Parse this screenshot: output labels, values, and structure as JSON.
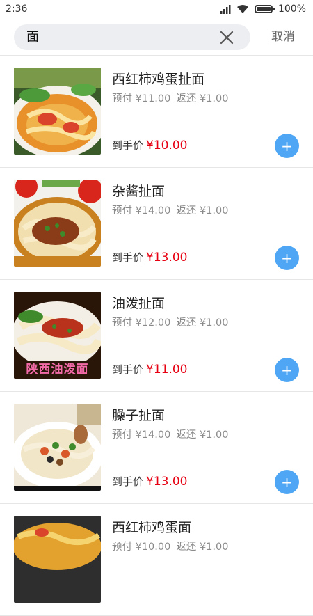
{
  "status": {
    "time": "2:36",
    "battery": "100%",
    "battery_level": 1.0
  },
  "search": {
    "value": "面",
    "cancel_label": "取消"
  },
  "items": [
    {
      "name": "西红柿鸡蛋扯面",
      "prepay": "预付 ¥11.00",
      "rebate": "返还 ¥1.00",
      "final_label": "到手价",
      "final_price": "¥10.00",
      "add_label": "+"
    },
    {
      "name": "杂酱扯面",
      "prepay": "预付 ¥14.00",
      "rebate": "返还 ¥1.00",
      "final_label": "到手价",
      "final_price": "¥13.00",
      "add_label": "+"
    },
    {
      "name": "油泼扯面",
      "prepay": "预付 ¥12.00",
      "rebate": "返还 ¥1.00",
      "final_label": "到手价",
      "final_price": "¥11.00",
      "add_label": "+",
      "image_caption": "陕西油泼面"
    },
    {
      "name": "臊子扯面",
      "prepay": "预付 ¥14.00",
      "rebate": "返还 ¥1.00",
      "final_label": "到手价",
      "final_price": "¥13.00",
      "add_label": "+"
    },
    {
      "name": "西红柿鸡蛋面",
      "prepay": "预付 ¥10.00",
      "rebate": "返还 ¥1.00"
    }
  ]
}
